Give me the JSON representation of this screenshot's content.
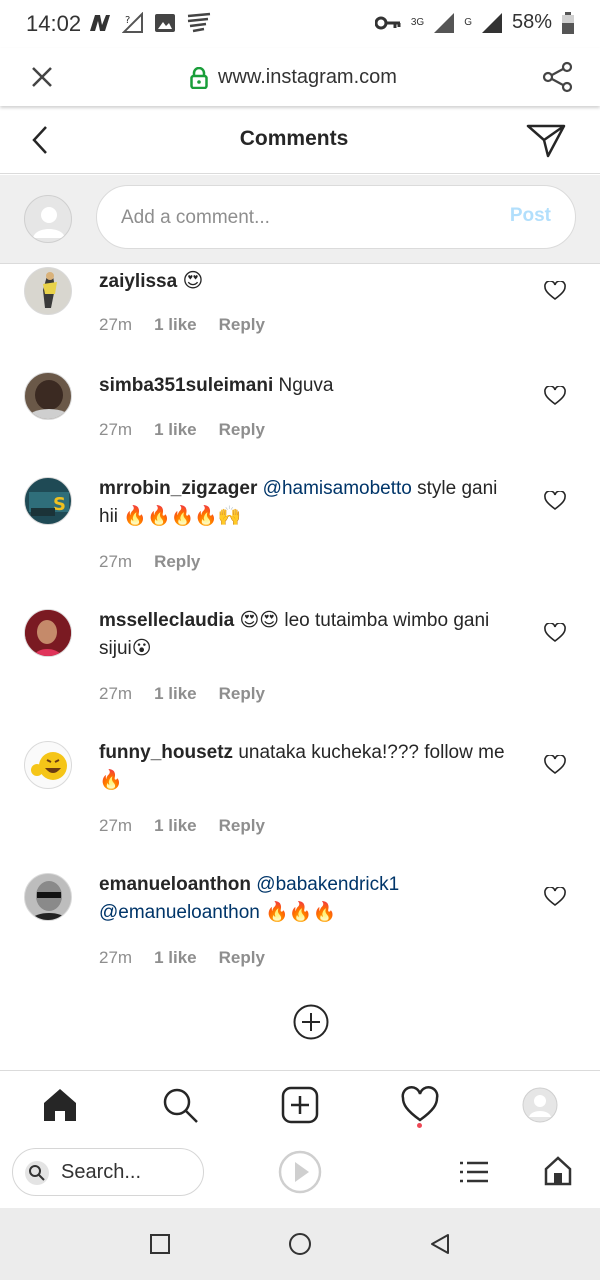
{
  "status_bar": {
    "time": "14:02",
    "battery": "58%",
    "net_3g": "3G",
    "net_g": "G",
    "icons": [
      "n-icon",
      "signal-question-icon",
      "image-icon",
      "sync-icon",
      "key-icon",
      "signal-icon",
      "battery-icon"
    ]
  },
  "browser": {
    "url": "www.instagram.com",
    "icons": [
      "close-icon",
      "lock-icon",
      "share-icon"
    ]
  },
  "header": {
    "title": "Comments"
  },
  "add_comment": {
    "placeholder": "Add a comment...",
    "post_label": "Post"
  },
  "comments": [
    {
      "username": "zaiylissa",
      "text": "😍",
      "time": "27m",
      "likes": "1 like",
      "reply": "Reply"
    },
    {
      "username": "simba351suleimani",
      "text": "Nguva",
      "time": "27m",
      "likes": "1 like",
      "reply": "Reply"
    },
    {
      "username": "mrrobin_zigzager",
      "mention": "@hamisamobetto",
      "text": "style gani hii 🔥🔥🔥🔥🙌",
      "time": "27m",
      "reply": "Reply"
    },
    {
      "username": "msselleclaudia",
      "text": "😍😍 leo tutaimba wimbo gani sijui😮",
      "time": "27m",
      "likes": "1 like",
      "reply": "Reply"
    },
    {
      "username": "funny_housetz",
      "text": "unataka kucheka!??? follow me🔥",
      "time": "27m",
      "likes": "1 like",
      "reply": "Reply"
    },
    {
      "username": "emanueloanthon",
      "mention": "@babakendrick1",
      "mention2": "@emanueloanthon",
      "text": "🔥🔥🔥",
      "time": "27m",
      "likes": "1 like",
      "reply": "Reply"
    }
  ],
  "bottom_nav": [
    "home-icon",
    "search-icon",
    "new-post-icon",
    "activity-icon",
    "profile-icon"
  ],
  "browser_bottom": {
    "search_label": "Search..."
  },
  "colors": {
    "mention": "#003569",
    "post_disabled": "#b2dffc",
    "meta": "#8e8e8e",
    "activity_dot": "#ed4956"
  }
}
